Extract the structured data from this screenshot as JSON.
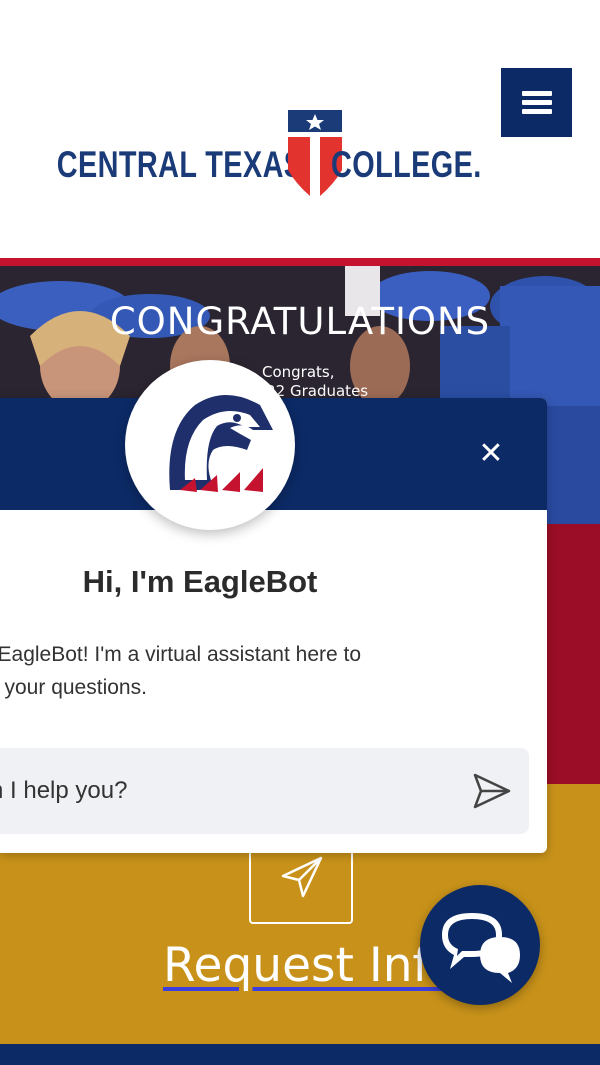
{
  "header": {
    "logo": {
      "left_text": "CENTRAL TEXAS",
      "right_text": "COLLEGE."
    },
    "menu_button": {
      "icon": "hamburger-menu-icon"
    }
  },
  "hero": {
    "title": "CONGRATULATIONS",
    "subtitle_line1": "Congrats,",
    "subtitle_line2": "'22 Graduates"
  },
  "chatbot": {
    "title": "Hi, I'm EagleBot",
    "intro": "n EagleBot! I'm a virtual assistant here to\ner your questions.",
    "input_placeholder": "n I help you?",
    "close_icon": "close-icon",
    "send_icon": "send-icon",
    "avatar_icon": "eagle-mascot-icon"
  },
  "cta": {
    "request_label": "Request Info",
    "request_icon": "paper-plane-icon"
  },
  "launcher": {
    "icon": "chat-bubbles-icon"
  },
  "colors": {
    "navy": "#0c2a66",
    "red": "#c4122f",
    "dark_red": "#9b0d26",
    "gold": "#c8921a"
  }
}
